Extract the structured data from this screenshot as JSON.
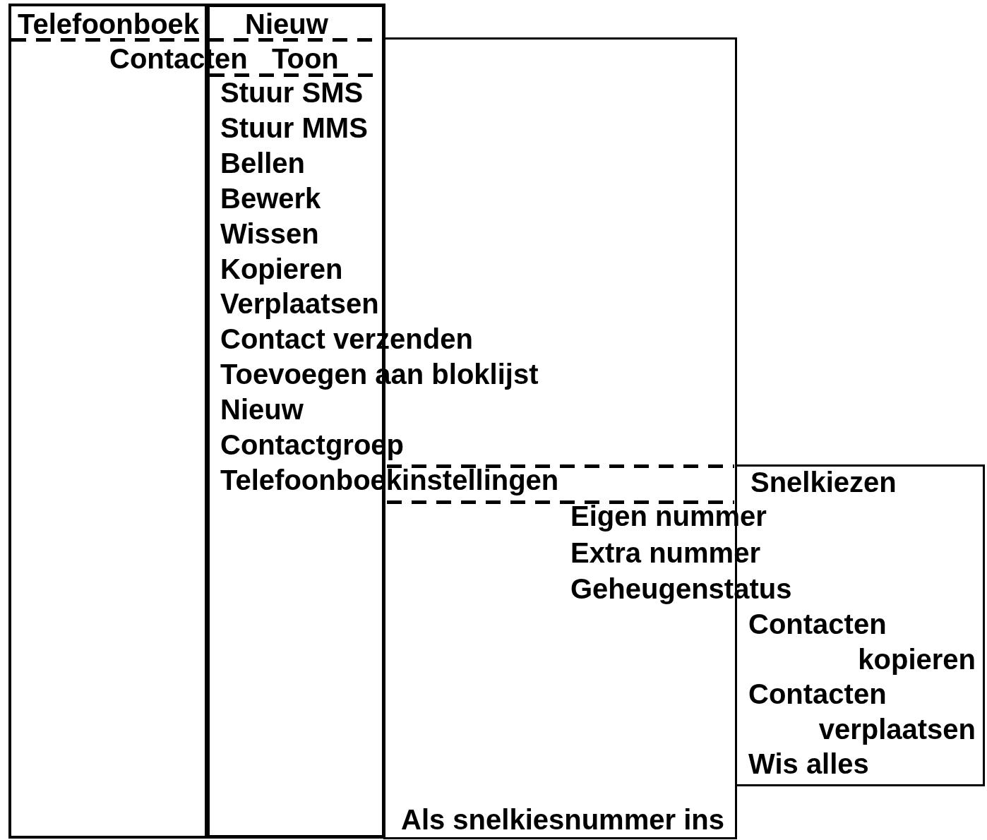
{
  "phonebook_column": {
    "title": "Telefoonboek",
    "subtitle": "Contacten"
  },
  "contacts_menu": {
    "title": "Nieuw",
    "subtitle": "Toon",
    "items": [
      "Stuur SMS",
      "Stuur MMS",
      "Bellen",
      "Bewerk",
      "Wissen",
      "Kopieren",
      "Verplaatsen",
      "Contact verzenden",
      "Toevoegen aan bloklijst",
      "Nieuw",
      "Contactgroep",
      "Telefoonboekinstellingen"
    ]
  },
  "settings_menu": {
    "items": [
      "Eigen nummer",
      "Extra nummer",
      "Geheugenstatus"
    ],
    "footer": "Als snelkiesnummer ins"
  },
  "speed_dial_box": {
    "title": "Snelkiezen",
    "items": [
      "Contacten kopieren",
      "Contacten verplaatsen",
      "Wis alles"
    ]
  }
}
